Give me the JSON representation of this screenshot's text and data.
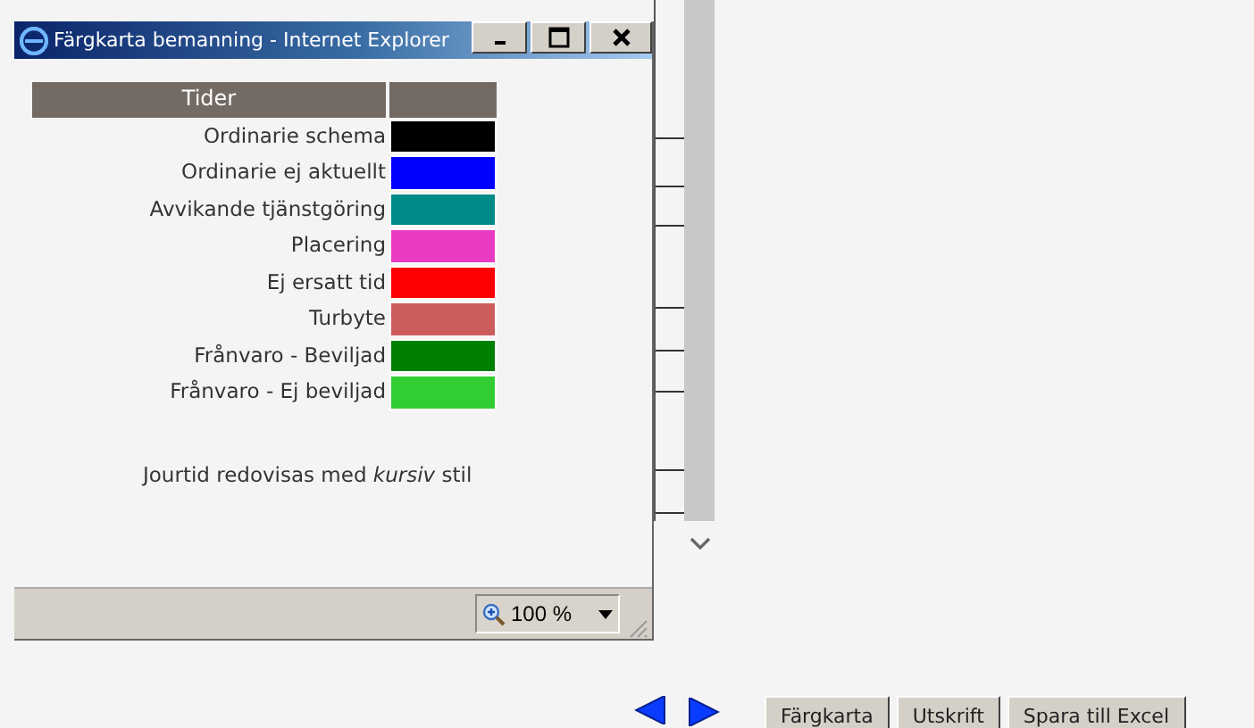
{
  "window": {
    "title": "Färgkarta bemanning - Internet Explorer"
  },
  "legend": {
    "header": "Tider",
    "rows": [
      {
        "label": "Ordinarie schema",
        "color": "#000000"
      },
      {
        "label": "Ordinarie ej aktuellt",
        "color": "#0000ff"
      },
      {
        "label": "Avvikande tjänstgöring",
        "color": "#008b8b"
      },
      {
        "label": "Placering",
        "color": "#e83ac3"
      },
      {
        "label": "Ej ersatt tid",
        "color": "#ff0000"
      },
      {
        "label": "Turbyte",
        "color": "#cd5c5c"
      },
      {
        "label": "Frånvaro - Beviljad",
        "color": "#008000"
      },
      {
        "label": "Frånvaro - Ej beviljad",
        "color": "#32cd32"
      }
    ]
  },
  "note": "Jourtid redovisas med *kursiv* stil",
  "status_bar": {
    "zoom": "100 %"
  },
  "buttons": [
    "Färgkarta",
    "Utskrift",
    "Spara till Excel"
  ]
}
